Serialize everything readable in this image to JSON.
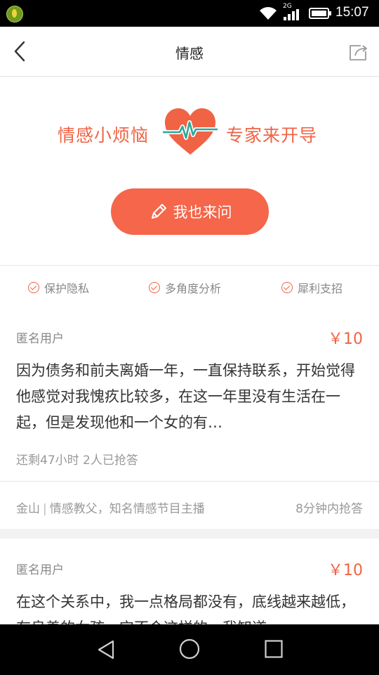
{
  "status_bar": {
    "network": "2G",
    "time": "15:07"
  },
  "header": {
    "title": "情感"
  },
  "hero": {
    "slogan_left": "情感小烦恼",
    "slogan_right": "专家来开导",
    "ask_button": "我也来问",
    "accent_color": "#f5664a"
  },
  "features": [
    {
      "label": "保护隐私",
      "icon": "check-circle-icon"
    },
    {
      "label": "多角度分析",
      "icon": "check-circle-icon"
    },
    {
      "label": "犀利支招",
      "icon": "check-circle-icon"
    }
  ],
  "questions": [
    {
      "user": "匿名用户",
      "price": "￥10",
      "text": "因为债务和前夫离婚一年，一直保持联系，开始觉得他感觉对我愧疚比较多，在这一年里没有生活在一起，但是发现他和一个女的有…",
      "meta": "还剩47小时  2人已抢答",
      "expert_name": "金山",
      "expert_title": "情感教父，知名情感节目主播",
      "answer_time": "8分钟内抢答"
    },
    {
      "user": "匿名用户",
      "price": "￥10",
      "text": "在这个关系中，我一点格局都没有，底线越来越低，有良善的女孩，它不会这样的，我知道"
    }
  ]
}
